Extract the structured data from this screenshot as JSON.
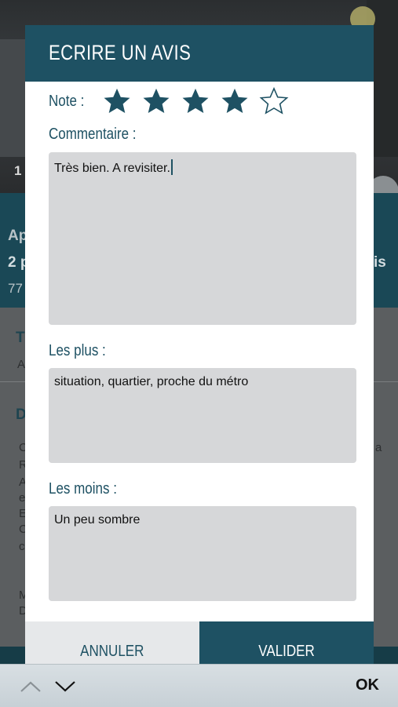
{
  "background": {
    "photo_index": "1",
    "band_line1": "Ap",
    "band_line2": "2 p",
    "band_line2_right": "is",
    "band_line3": "77",
    "section1_head": "Tl",
    "section1_text": "A",
    "section2_head": "D",
    "section2_lines": [
      "C",
      "R",
      "A",
      "e",
      "E",
      "C",
      "c"
    ],
    "section2_right": "a",
    "footer_lines": [
      "M",
      "D"
    ]
  },
  "modal": {
    "title": "ECRIRE UN AVIS",
    "note_label": "Note :",
    "rating": 4,
    "max_rating": 5,
    "comment_label": "Commentaire :",
    "comment_value": "Très bien. A revisiter.",
    "pros_label": "Les plus :",
    "pros_value": "situation, quartier, proche du métro",
    "cons_label": "Les moins :",
    "cons_value": "Un peu sombre",
    "cancel_label": "ANNULER",
    "validate_label": "VALIDER"
  },
  "keyboard_bar": {
    "prev_icon": "chevron-up-icon",
    "next_icon": "chevron-down-icon",
    "ok_label": "OK"
  },
  "colors": {
    "primary": "#1e5163",
    "field_bg": "#d6d7d9",
    "cancel_bg": "#e6e8ea"
  }
}
